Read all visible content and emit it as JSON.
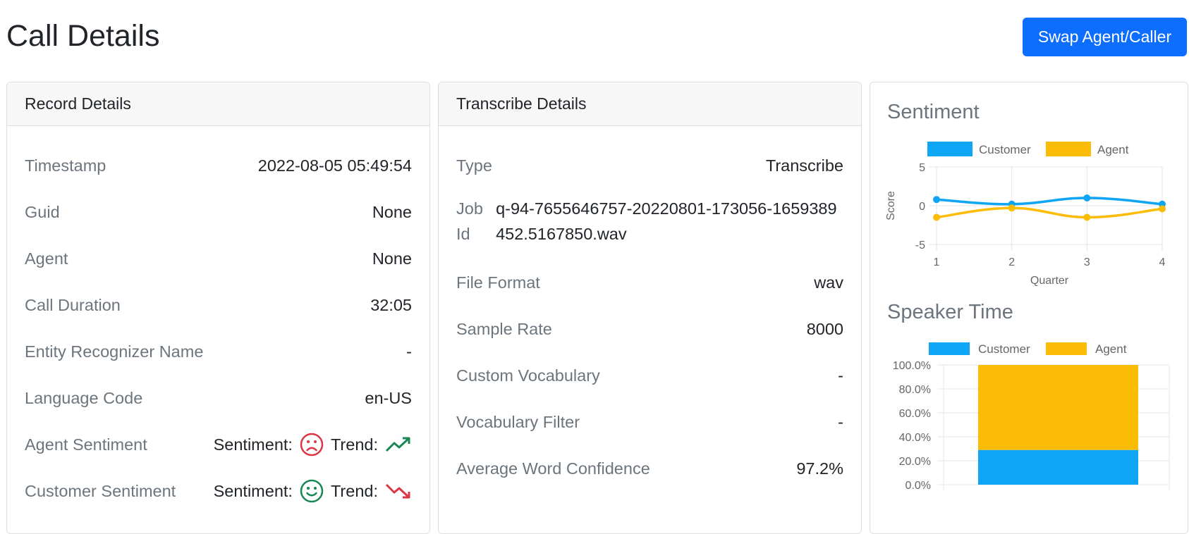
{
  "page": {
    "title": "Call Details",
    "swap_button": "Swap Agent/Caller"
  },
  "record": {
    "header": "Record Details",
    "rows": [
      {
        "label": "Timestamp",
        "value": "2022-08-05 05:49:54"
      },
      {
        "label": "Guid",
        "value": "None"
      },
      {
        "label": "Agent",
        "value": "None"
      },
      {
        "label": "Call Duration",
        "value": "32:05"
      },
      {
        "label": "Entity Recognizer Name",
        "value": "-"
      },
      {
        "label": "Language Code",
        "value": "en-US"
      }
    ],
    "agent_sentiment": {
      "label": "Agent Sentiment",
      "sentiment_label": "Sentiment:",
      "trend_label": "Trend:",
      "face": "frown-icon",
      "trend": "trend-up-icon",
      "face_color": "#dc3545",
      "trend_color": "#198754"
    },
    "customer_sentiment": {
      "label": "Customer Sentiment",
      "sentiment_label": "Sentiment:",
      "trend_label": "Trend:",
      "face": "smile-icon",
      "trend": "trend-down-icon",
      "face_color": "#198754",
      "trend_color": "#dc3545"
    }
  },
  "transcribe": {
    "header": "Transcribe Details",
    "type_label": "Type",
    "type_value": "Transcribe",
    "job_label_line1": "Job",
    "job_label_line2": "Id",
    "job_value": "q-94-7655646757-20220801-173056-1659389452.5167850.wav",
    "rows": [
      {
        "label": "File Format",
        "value": "wav"
      },
      {
        "label": "Sample Rate",
        "value": "8000"
      },
      {
        "label": "Custom Vocabulary",
        "value": "-"
      },
      {
        "label": "Vocabulary Filter",
        "value": "-"
      },
      {
        "label": "Average Word Confidence",
        "value": "97.2%"
      }
    ]
  },
  "charts": {
    "sentiment_title": "Sentiment",
    "speaker_title": "Speaker Time"
  },
  "chart_data": [
    {
      "type": "line",
      "title": "Sentiment",
      "xlabel": "Quarter",
      "ylabel": "Score",
      "x": [
        1,
        2,
        3,
        4
      ],
      "ylim": [
        -5,
        5
      ],
      "yticks": [
        5,
        0,
        -5
      ],
      "series": [
        {
          "name": "Customer",
          "color": "#0ea5f5",
          "values": [
            0.8,
            0.2,
            1.0,
            0.2
          ]
        },
        {
          "name": "Agent",
          "color": "#fbbc05",
          "values": [
            -1.5,
            -0.3,
            -1.5,
            -0.4
          ]
        }
      ],
      "legend": "top",
      "grid": true
    },
    {
      "type": "bar",
      "stacked": true,
      "title": "Speaker Time",
      "categories": [
        ""
      ],
      "series": [
        {
          "name": "Customer",
          "color": "#0ea5f5",
          "values": [
            29
          ]
        },
        {
          "name": "Agent",
          "color": "#fbbc05",
          "values": [
            71
          ]
        }
      ],
      "ylim": [
        0,
        100
      ],
      "yticks": [
        "100.0%",
        "80.0%",
        "60.0%",
        "40.0%",
        "20.0%",
        "0.0%"
      ],
      "legend": "top",
      "grid": true
    }
  ]
}
